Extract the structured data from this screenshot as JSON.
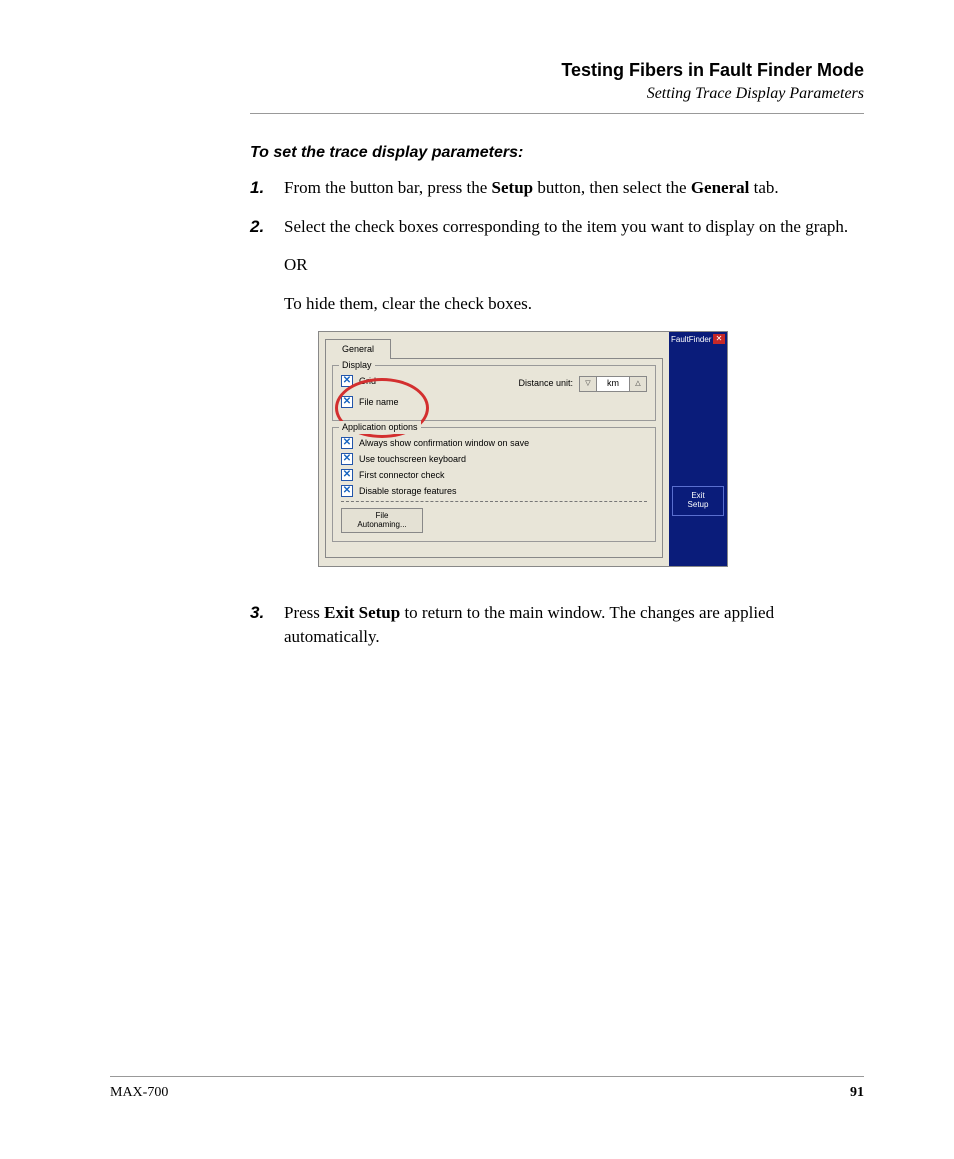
{
  "header": {
    "title": "Testing Fibers in Fault Finder Mode",
    "subtitle": "Setting Trace Display Parameters"
  },
  "instructions": {
    "heading": "To set the trace display parameters:",
    "step1_num": "1.",
    "step1_a": "From the button bar, press the ",
    "step1_b": "Setup",
    "step1_c": " button, then select the ",
    "step1_d": "General",
    "step1_e": " tab.",
    "step2_num": "2.",
    "step2_a": "Select the check boxes corresponding to the item you want to display on the graph.",
    "step2_b": "OR",
    "step2_c": "To hide them, clear the check boxes.",
    "step3_num": "3.",
    "step3_a": "Press ",
    "step3_b": "Exit Setup",
    "step3_c": " to return to the main window. The changes are applied automatically."
  },
  "screenshot": {
    "tab": "General",
    "display_group": "Display",
    "grid": "Grid",
    "filename": "File name",
    "distance_label": "Distance unit:",
    "distance_value": "km",
    "app_group": "Application options",
    "opt1": "Always show confirmation window on save",
    "opt2": "Use touchscreen keyboard",
    "opt3": "First connector check",
    "opt4": "Disable storage features",
    "file_btn_l1": "File",
    "file_btn_l2": "Autonaming...",
    "side_title": "FaultFinder",
    "close_x": "✕",
    "exit_l1": "Exit",
    "exit_l2": "Setup",
    "check_mark": "✕"
  },
  "footer": {
    "left": "MAX-700",
    "right": "91"
  }
}
